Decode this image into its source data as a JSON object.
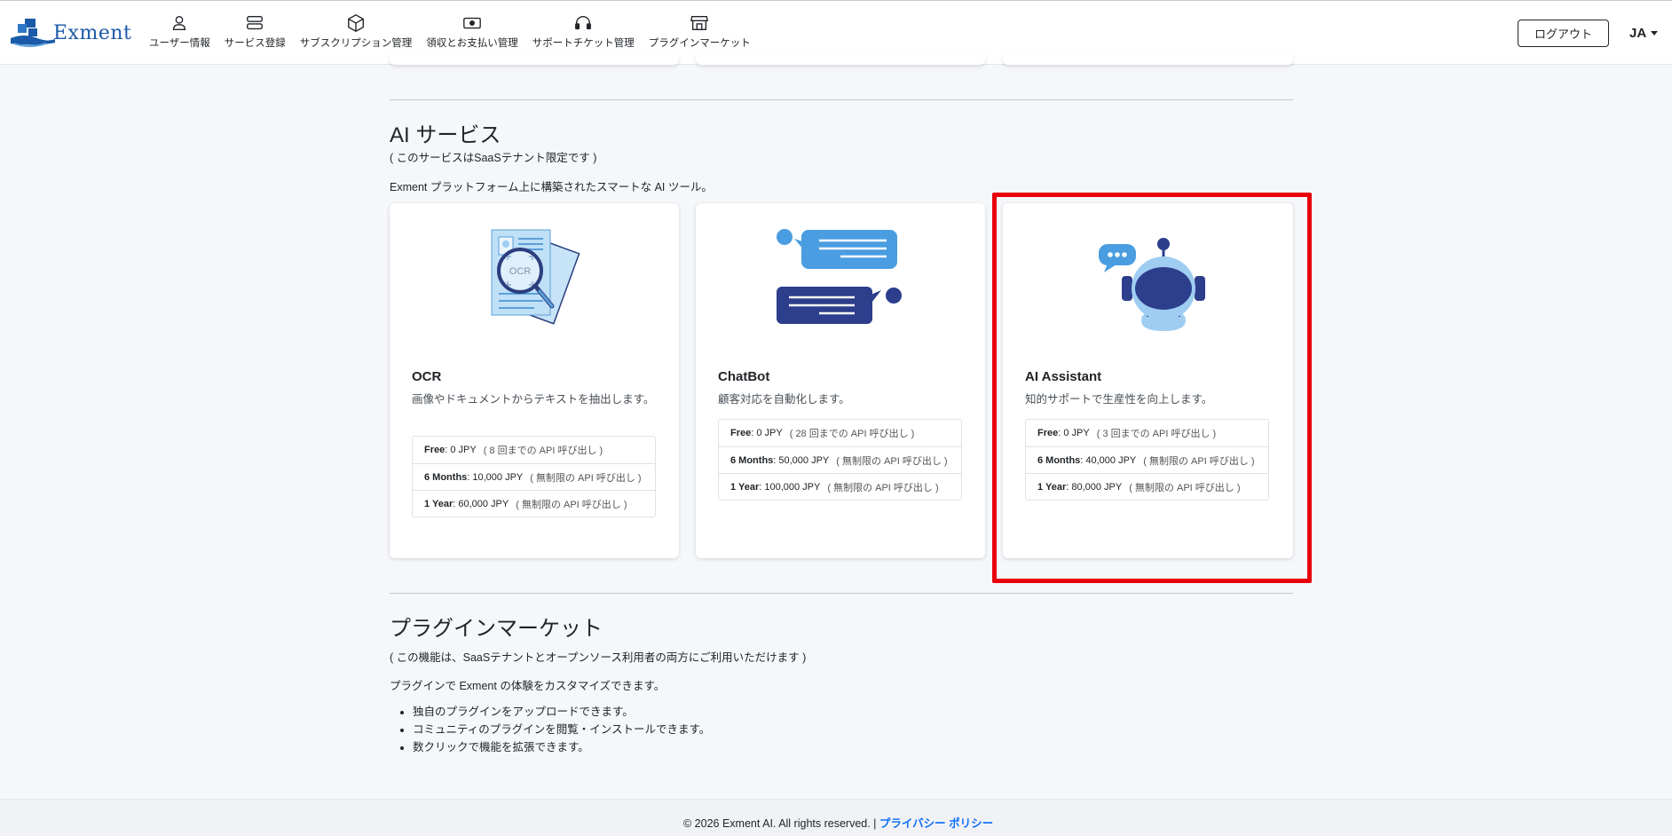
{
  "header": {
    "logo_text": "Exment",
    "nav": [
      {
        "label": "ユーザー情報",
        "icon": "user-icon"
      },
      {
        "label": "サービス登録",
        "icon": "server-icon"
      },
      {
        "label": "サブスクリプション管理",
        "icon": "box-icon"
      },
      {
        "label": "領収とお支払い管理",
        "icon": "money-icon"
      },
      {
        "label": "サポートチケット管理",
        "icon": "headset-icon"
      },
      {
        "label": "プラグインマーケット",
        "icon": "store-icon"
      }
    ],
    "logout_label": "ログアウト",
    "language": "JA"
  },
  "ai_section": {
    "title": "AI サービス",
    "restriction": "( このサービスはSaaSテナント限定です )",
    "description": "Exment プラットフォーム上に構築されたスマートな AI ツール。",
    "cards": [
      {
        "title": "OCR",
        "description": "画像やドキュメントからテキストを抽出します。",
        "illustration_label": "OCR",
        "icon": "ocr-document-icon",
        "prices": [
          {
            "plan": "Free",
            "price": " : 0 JPY",
            "quota": "( 8 回までの API 呼び出し )"
          },
          {
            "plan": "6 Months",
            "price": " : 10,000 JPY",
            "quota": "( 無制限の API 呼び出し )"
          },
          {
            "plan": "1 Year",
            "price": " : 60,000 JPY",
            "quota": "( 無制限の API 呼び出し )"
          }
        ]
      },
      {
        "title": "ChatBot",
        "description": "顧客対応を自動化します。",
        "icon": "chat-bubbles-icon",
        "prices": [
          {
            "plan": "Free",
            "price": " : 0 JPY",
            "quota": "( 28 回までの API 呼び出し )"
          },
          {
            "plan": "6 Months",
            "price": " : 50,000 JPY",
            "quota": "( 無制限の API 呼び出し )"
          },
          {
            "plan": "1 Year",
            "price": " : 100,000 JPY",
            "quota": "( 無制限の API 呼び出し )"
          }
        ]
      },
      {
        "title": "AI Assistant",
        "description": "知的サポートで生産性を向上します。",
        "icon": "robot-assistant-icon",
        "prices": [
          {
            "plan": "Free",
            "price": " : 0 JPY",
            "quota": "( 3 回までの API 呼び出し )"
          },
          {
            "plan": "6 Months",
            "price": " : 40,000 JPY",
            "quota": "( 無制限の API 呼び出し )"
          },
          {
            "plan": "1 Year",
            "price": " : 80,000 JPY",
            "quota": "( 無制限の API 呼び出し )"
          }
        ]
      }
    ]
  },
  "plugin_section": {
    "title": "プラグインマーケット",
    "restriction": "( この機能は、SaaSテナントとオープンソース利用者の両方にご利用いただけます )",
    "description": "プラグインで Exment の体験をカスタマイズできます。",
    "items": [
      "独自のプラグインをアップロードできます。",
      "コミュニティのプラグインを閲覧・インストールできます。",
      "数クリックで機能を拡張できます。"
    ]
  },
  "footer": {
    "copyright": "© 2026 Exment AI. All rights reserved. | ",
    "privacy_link": "プライバシー ポリシー"
  },
  "colors": {
    "accent": "#0d6efd",
    "highlight": "#e8000b",
    "illustration_light": "#9fcdf2",
    "illustration_dark": "#2c3e7f"
  }
}
